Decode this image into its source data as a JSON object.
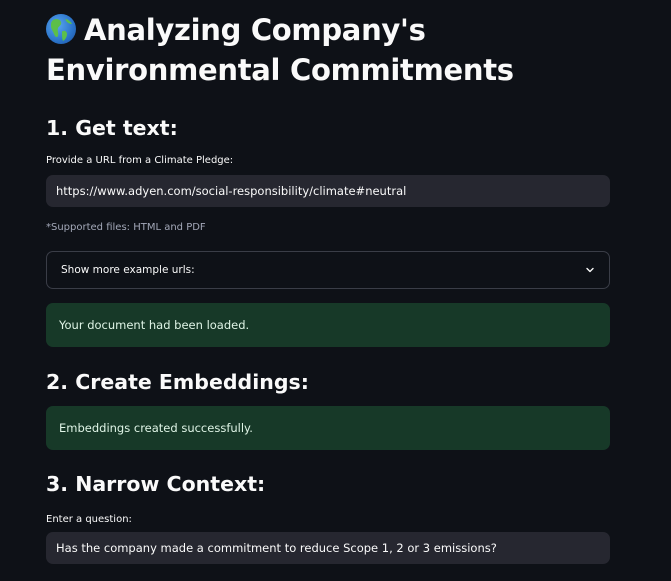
{
  "page": {
    "title": "Analyzing Company's Environmental Commitments",
    "title_line1": "Analyzing Company's",
    "title_line2": "Environmental Commitments",
    "title_icon": "globe-americas-icon"
  },
  "step1": {
    "heading": "1. Get text:",
    "url_label": "Provide a URL from a Climate Pledge:",
    "url_value": "https://www.adyen.com/social-responsibility/climate#neutral",
    "supported_caption": "*Supported files: HTML and PDF",
    "expander_label": "Show more example urls:",
    "expander_icon": "chevron-down-icon",
    "status": "Your document had been loaded."
  },
  "step2": {
    "heading": "2. Create Embeddings:",
    "status": "Embeddings created successfully."
  },
  "step3": {
    "heading": "3. Narrow Context:",
    "question_label": "Enter a question:",
    "question_value": "Has the company made a commitment to reduce Scope 1, 2 or 3 emissions?"
  },
  "colors": {
    "background": "#0e1117",
    "input_background": "#262730",
    "success_background": "#173928",
    "success_text": "#dff4e6",
    "caption_text": "#a3a8b8"
  }
}
